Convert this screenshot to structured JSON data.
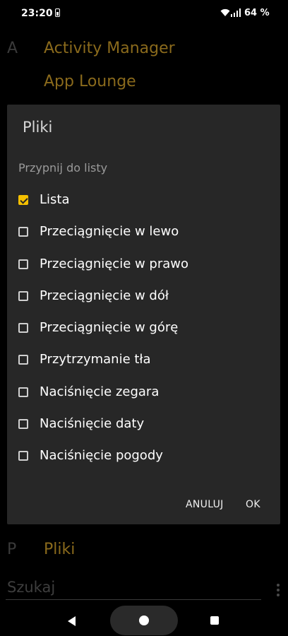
{
  "status": {
    "time": "23:20",
    "battery": "64 %"
  },
  "background": {
    "letter_a": "A",
    "apps_a": [
      "Activity Manager",
      "App Lounge"
    ],
    "letter_p": "P",
    "app_p": "Pliki"
  },
  "dialog": {
    "title": "Pliki",
    "section": "Przypnij do listy",
    "options": [
      {
        "label": "Lista",
        "checked": true
      },
      {
        "label": "Przeciągnięcie w lewo",
        "checked": false
      },
      {
        "label": "Przeciągnięcie w prawo",
        "checked": false
      },
      {
        "label": "Przeciągnięcie w dół",
        "checked": false
      },
      {
        "label": "Przeciągnięcie w górę",
        "checked": false
      },
      {
        "label": "Przytrzymanie tła",
        "checked": false
      },
      {
        "label": "Naciśnięcie zegara",
        "checked": false
      },
      {
        "label": "Naciśnięcie daty",
        "checked": false
      },
      {
        "label": "Naciśnięcie pogody",
        "checked": false
      }
    ],
    "cancel_label": "ANULUJ",
    "ok_label": "OK"
  },
  "search": {
    "placeholder": "Szukaj"
  },
  "colors": {
    "accent": "#f5c000",
    "dialog_bg": "#272727",
    "dimmed_app_text": "#8a6a1c"
  }
}
